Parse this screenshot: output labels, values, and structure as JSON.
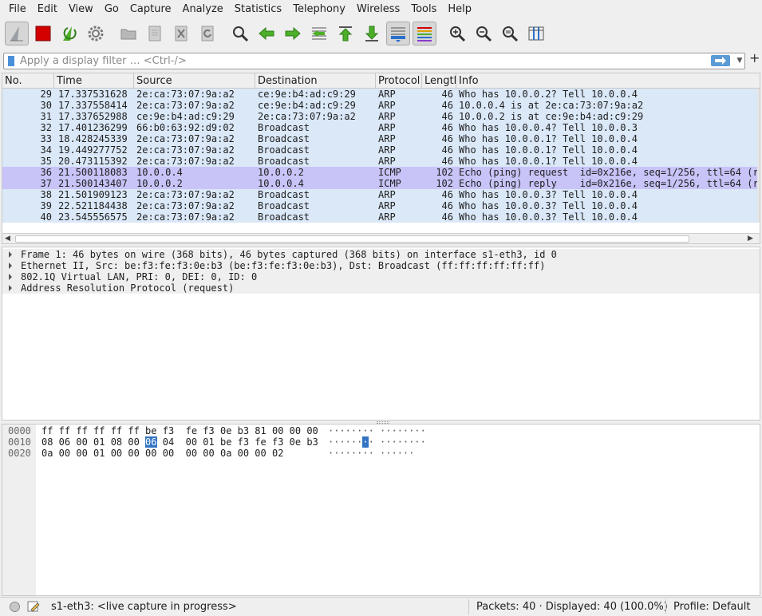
{
  "menu": [
    "File",
    "Edit",
    "View",
    "Go",
    "Capture",
    "Analyze",
    "Statistics",
    "Telephony",
    "Wireless",
    "Tools",
    "Help"
  ],
  "toolbar": {
    "buttons": [
      "start-capture",
      "stop-capture",
      "restart-capture",
      "capture-options",
      "open-file",
      "save-file",
      "close-file",
      "reload-file",
      "find-packet",
      "go-back",
      "go-forward",
      "go-to-packet",
      "go-first",
      "go-last",
      "auto-scroll",
      "colorize",
      "zoom-in",
      "zoom-out",
      "zoom-normal",
      "resize-columns"
    ],
    "colors": {
      "stop": "#d40000",
      "green": "#4caf28",
      "blue": "#2a6ecc"
    }
  },
  "filter": {
    "placeholder": "Apply a display filter … <Ctrl-/>",
    "value": ""
  },
  "packet_list": {
    "columns": [
      "No.",
      "Time",
      "Source",
      "Destination",
      "Protocol",
      "Length",
      "Info"
    ],
    "rows": [
      {
        "no": "29",
        "time": "17.337531628",
        "src": "2e:ca:73:07:9a:a2",
        "dst": "ce:9e:b4:ad:c9:29",
        "proto": "ARP",
        "len": "46",
        "info": "Who has 10.0.0.2? Tell 10.0.0.4",
        "kind": "arp"
      },
      {
        "no": "30",
        "time": "17.337558414",
        "src": "2e:ca:73:07:9a:a2",
        "dst": "ce:9e:b4:ad:c9:29",
        "proto": "ARP",
        "len": "46",
        "info": "10.0.0.4 is at 2e:ca:73:07:9a:a2",
        "kind": "arp"
      },
      {
        "no": "31",
        "time": "17.337652988",
        "src": "ce:9e:b4:ad:c9:29",
        "dst": "2e:ca:73:07:9a:a2",
        "proto": "ARP",
        "len": "46",
        "info": "10.0.0.2 is at ce:9e:b4:ad:c9:29",
        "kind": "arp"
      },
      {
        "no": "32",
        "time": "17.401236299",
        "src": "66:b0:63:92:d9:02",
        "dst": "Broadcast",
        "proto": "ARP",
        "len": "46",
        "info": "Who has 10.0.0.4? Tell 10.0.0.3",
        "kind": "arp"
      },
      {
        "no": "33",
        "time": "18.428245339",
        "src": "2e:ca:73:07:9a:a2",
        "dst": "Broadcast",
        "proto": "ARP",
        "len": "46",
        "info": "Who has 10.0.0.1? Tell 10.0.0.4",
        "kind": "arp"
      },
      {
        "no": "34",
        "time": "19.449277752",
        "src": "2e:ca:73:07:9a:a2",
        "dst": "Broadcast",
        "proto": "ARP",
        "len": "46",
        "info": "Who has 10.0.0.1? Tell 10.0.0.4",
        "kind": "arp"
      },
      {
        "no": "35",
        "time": "20.473115392",
        "src": "2e:ca:73:07:9a:a2",
        "dst": "Broadcast",
        "proto": "ARP",
        "len": "46",
        "info": "Who has 10.0.0.1? Tell 10.0.0.4",
        "kind": "arp"
      },
      {
        "no": "36",
        "time": "21.500118083",
        "src": "10.0.0.4",
        "dst": "10.0.0.2",
        "proto": "ICMP",
        "len": "102",
        "info": "Echo (ping) request  id=0x216e, seq=1/256, ttl=64 (r",
        "kind": "icmp"
      },
      {
        "no": "37",
        "time": "21.500143407",
        "src": "10.0.0.2",
        "dst": "10.0.0.4",
        "proto": "ICMP",
        "len": "102",
        "info": "Echo (ping) reply    id=0x216e, seq=1/256, ttl=64 (r",
        "kind": "icmp"
      },
      {
        "no": "38",
        "time": "21.501909123",
        "src": "2e:ca:73:07:9a:a2",
        "dst": "Broadcast",
        "proto": "ARP",
        "len": "46",
        "info": "Who has 10.0.0.3? Tell 10.0.0.4",
        "kind": "arp"
      },
      {
        "no": "39",
        "time": "22.521184438",
        "src": "2e:ca:73:07:9a:a2",
        "dst": "Broadcast",
        "proto": "ARP",
        "len": "46",
        "info": "Who has 10.0.0.3? Tell 10.0.0.4",
        "kind": "arp"
      },
      {
        "no": "40",
        "time": "23.545556575",
        "src": "2e:ca:73:07:9a:a2",
        "dst": "Broadcast",
        "proto": "ARP",
        "len": "46",
        "info": "Who has 10.0.0.3? Tell 10.0.0.4",
        "kind": "arp"
      }
    ]
  },
  "details": [
    "Frame 1: 46 bytes on wire (368 bits), 46 bytes captured (368 bits) on interface s1-eth3, id 0",
    "Ethernet II, Src: be:f3:fe:f3:0e:b3 (be:f3:fe:f3:0e:b3), Dst: Broadcast (ff:ff:ff:ff:ff:ff)",
    "802.1Q Virtual LAN, PRI: 0, DEI: 0, ID: 0",
    "Address Resolution Protocol (request)"
  ],
  "bytes": [
    {
      "offset": "0000",
      "hex_before": "ff ff ff ff ff ff be f3  fe f3 0e b3 81 00 00 00",
      "hex_hl": "",
      "hex_after": "",
      "ascii_before": "········ ········",
      "ascii_hl": "",
      "ascii_after": ""
    },
    {
      "offset": "0010",
      "hex_before": "08 06 00 01 08 00 ",
      "hex_hl": "06",
      "hex_after": " 04  00 01 be f3 fe f3 0e b3",
      "ascii_before": "······",
      "ascii_hl": "·",
      "ascii_after": "· ········"
    },
    {
      "offset": "0020",
      "hex_before": "0a 00 00 01 00 00 00 00  00 00 0a 00 00 02",
      "hex_hl": "",
      "hex_after": "",
      "ascii_before": "········ ······",
      "ascii_hl": "",
      "ascii_after": ""
    }
  ],
  "status": {
    "interface": "s1-eth3: <live capture in progress>",
    "packets": "Packets: 40 · Displayed: 40 (100.0%)",
    "profile": "Profile: Default"
  },
  "colors": {
    "arp_row": "#dae8f8",
    "icmp_row": "#c8c4f8",
    "selection": "#3374c3"
  }
}
